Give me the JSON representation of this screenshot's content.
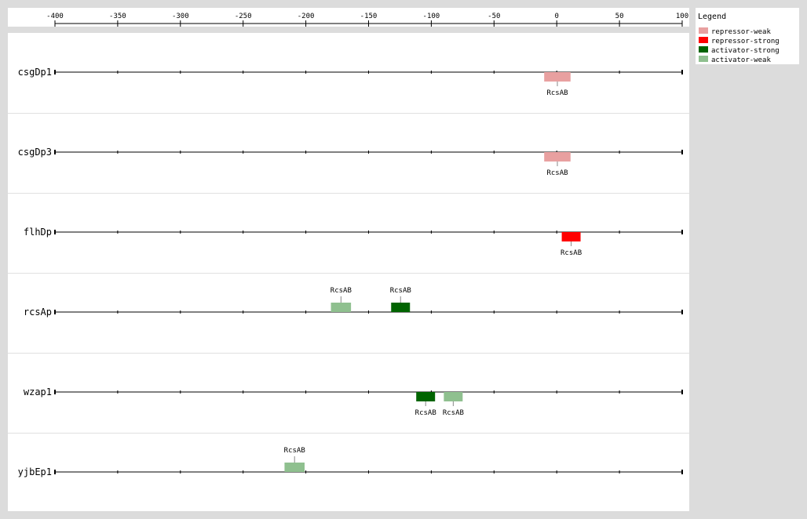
{
  "axis": {
    "min": -400,
    "max": 100,
    "ticks": [
      "-400",
      "-350",
      "-300",
      "-250",
      "-200",
      "-150",
      "-100",
      "-50",
      "0",
      "50",
      "100"
    ]
  },
  "legend": {
    "title": "Legend",
    "items": [
      {
        "label": "repressor-weak",
        "color": "#e8a0a0"
      },
      {
        "label": "repressor-strong",
        "color": "#ff0000"
      },
      {
        "label": "activator-strong",
        "color": "#006400"
      },
      {
        "label": "activator-weak",
        "color": "#8fc08f"
      }
    ]
  },
  "promoters": [
    {
      "name": "csgDp1",
      "sites": [
        {
          "label": "RcsAB",
          "type": "repressor-weak",
          "start": -10,
          "end": 11,
          "side": "below"
        }
      ]
    },
    {
      "name": "csgDp3",
      "sites": [
        {
          "label": "RcsAB",
          "type": "repressor-weak",
          "start": -10,
          "end": 11,
          "side": "below"
        }
      ]
    },
    {
      "name": "flhDp",
      "sites": [
        {
          "label": "RcsAB",
          "type": "repressor-strong",
          "start": 4,
          "end": 19,
          "side": "below"
        }
      ]
    },
    {
      "name": "rcsAp",
      "sites": [
        {
          "label": "RcsAB",
          "type": "activator-weak",
          "start": -180,
          "end": -164,
          "side": "above"
        },
        {
          "label": "RcsAB",
          "type": "activator-strong",
          "start": -132,
          "end": -117,
          "side": "above"
        }
      ]
    },
    {
      "name": "wzap1",
      "sites": [
        {
          "label": "RcsAB",
          "type": "activator-strong",
          "start": -112,
          "end": -97,
          "side": "below"
        },
        {
          "label": "RcsAB",
          "type": "activator-weak",
          "start": -90,
          "end": -75,
          "side": "below"
        }
      ]
    },
    {
      "name": "yjbEp1",
      "sites": [
        {
          "label": "RcsAB",
          "type": "activator-weak",
          "start": -217,
          "end": -201,
          "side": "above"
        }
      ]
    }
  ]
}
